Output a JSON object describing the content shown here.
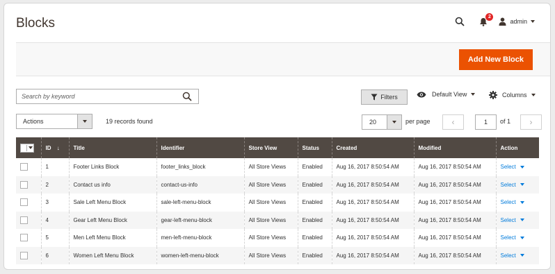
{
  "header": {
    "title": "Blocks",
    "notifications_count": "2",
    "user_name": "admin"
  },
  "page_actions": {
    "add_new_label": "Add New Block"
  },
  "toolbar": {
    "search_placeholder": "Search by keyword",
    "filters_label": "Filters",
    "view_label": "Default View",
    "columns_label": "Columns",
    "actions_label": "Actions",
    "records_text": "19 records found",
    "per_page_value": "20",
    "per_page_label": "per page",
    "page_current": "1",
    "page_of": "of 1"
  },
  "grid": {
    "columns": [
      "ID",
      "Title",
      "Identifier",
      "Store View",
      "Status",
      "Created",
      "Modified",
      "Action"
    ],
    "rows": [
      {
        "id": "1",
        "title": "Footer Links Block",
        "identifier": "footer_links_block",
        "store": "All Store Views",
        "status": "Enabled",
        "created": "Aug 16, 2017 8:50:54 AM",
        "modified": "Aug 16, 2017 8:50:54 AM",
        "action": "Select"
      },
      {
        "id": "2",
        "title": "Contact us info",
        "identifier": "contact-us-info",
        "store": "All Store Views",
        "status": "Enabled",
        "created": "Aug 16, 2017 8:50:54 AM",
        "modified": "Aug 16, 2017 8:50:54 AM",
        "action": "Select"
      },
      {
        "id": "3",
        "title": "Sale Left Menu Block",
        "identifier": "sale-left-menu-block",
        "store": "All Store Views",
        "status": "Enabled",
        "created": "Aug 16, 2017 8:50:54 AM",
        "modified": "Aug 16, 2017 8:50:54 AM",
        "action": "Select"
      },
      {
        "id": "4",
        "title": "Gear Left Menu Block",
        "identifier": "gear-left-menu-block",
        "store": "All Store Views",
        "status": "Enabled",
        "created": "Aug 16, 2017 8:50:54 AM",
        "modified": "Aug 16, 2017 8:50:54 AM",
        "action": "Select"
      },
      {
        "id": "5",
        "title": "Men Left Menu Block",
        "identifier": "men-left-menu-block",
        "store": "All Store Views",
        "status": "Enabled",
        "created": "Aug 16, 2017 8:50:54 AM",
        "modified": "Aug 16, 2017 8:50:54 AM",
        "action": "Select"
      },
      {
        "id": "6",
        "title": "Women Left Menu Block",
        "identifier": "women-left-menu-block",
        "store": "All Store Views",
        "status": "Enabled",
        "created": "Aug 16, 2017 8:50:54 AM",
        "modified": "Aug 16, 2017 8:50:54 AM",
        "action": "Select"
      }
    ]
  },
  "icons": {
    "search": "search-icon",
    "notifications": "bell-icon",
    "user": "user-icon",
    "filter": "funnel-icon",
    "view": "eye-icon",
    "columns": "gear-icon",
    "sort": "arrow-down-icon"
  },
  "colors": {
    "accent": "#eb5202",
    "table_header": "#514943",
    "link": "#007bdb",
    "badge": "#e22626"
  }
}
